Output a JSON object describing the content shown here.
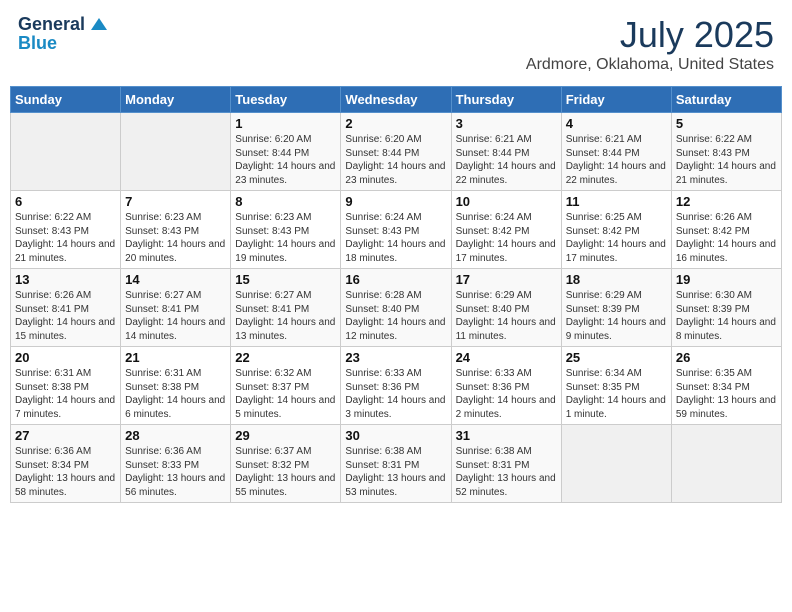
{
  "header": {
    "logo_general": "General",
    "logo_blue": "Blue",
    "month_title": "July 2025",
    "location": "Ardmore, Oklahoma, United States"
  },
  "days_of_week": [
    "Sunday",
    "Monday",
    "Tuesday",
    "Wednesday",
    "Thursday",
    "Friday",
    "Saturday"
  ],
  "weeks": [
    [
      {
        "day": "",
        "empty": true
      },
      {
        "day": "",
        "empty": true
      },
      {
        "day": "1",
        "sunrise": "6:20 AM",
        "sunset": "8:44 PM",
        "daylight": "14 hours and 23 minutes."
      },
      {
        "day": "2",
        "sunrise": "6:20 AM",
        "sunset": "8:44 PM",
        "daylight": "14 hours and 23 minutes."
      },
      {
        "day": "3",
        "sunrise": "6:21 AM",
        "sunset": "8:44 PM",
        "daylight": "14 hours and 22 minutes."
      },
      {
        "day": "4",
        "sunrise": "6:21 AM",
        "sunset": "8:44 PM",
        "daylight": "14 hours and 22 minutes."
      },
      {
        "day": "5",
        "sunrise": "6:22 AM",
        "sunset": "8:43 PM",
        "daylight": "14 hours and 21 minutes."
      }
    ],
    [
      {
        "day": "6",
        "sunrise": "6:22 AM",
        "sunset": "8:43 PM",
        "daylight": "14 hours and 21 minutes."
      },
      {
        "day": "7",
        "sunrise": "6:23 AM",
        "sunset": "8:43 PM",
        "daylight": "14 hours and 20 minutes."
      },
      {
        "day": "8",
        "sunrise": "6:23 AM",
        "sunset": "8:43 PM",
        "daylight": "14 hours and 19 minutes."
      },
      {
        "day": "9",
        "sunrise": "6:24 AM",
        "sunset": "8:43 PM",
        "daylight": "14 hours and 18 minutes."
      },
      {
        "day": "10",
        "sunrise": "6:24 AM",
        "sunset": "8:42 PM",
        "daylight": "14 hours and 17 minutes."
      },
      {
        "day": "11",
        "sunrise": "6:25 AM",
        "sunset": "8:42 PM",
        "daylight": "14 hours and 17 minutes."
      },
      {
        "day": "12",
        "sunrise": "6:26 AM",
        "sunset": "8:42 PM",
        "daylight": "14 hours and 16 minutes."
      }
    ],
    [
      {
        "day": "13",
        "sunrise": "6:26 AM",
        "sunset": "8:41 PM",
        "daylight": "14 hours and 15 minutes."
      },
      {
        "day": "14",
        "sunrise": "6:27 AM",
        "sunset": "8:41 PM",
        "daylight": "14 hours and 14 minutes."
      },
      {
        "day": "15",
        "sunrise": "6:27 AM",
        "sunset": "8:41 PM",
        "daylight": "14 hours and 13 minutes."
      },
      {
        "day": "16",
        "sunrise": "6:28 AM",
        "sunset": "8:40 PM",
        "daylight": "14 hours and 12 minutes."
      },
      {
        "day": "17",
        "sunrise": "6:29 AM",
        "sunset": "8:40 PM",
        "daylight": "14 hours and 11 minutes."
      },
      {
        "day": "18",
        "sunrise": "6:29 AM",
        "sunset": "8:39 PM",
        "daylight": "14 hours and 9 minutes."
      },
      {
        "day": "19",
        "sunrise": "6:30 AM",
        "sunset": "8:39 PM",
        "daylight": "14 hours and 8 minutes."
      }
    ],
    [
      {
        "day": "20",
        "sunrise": "6:31 AM",
        "sunset": "8:38 PM",
        "daylight": "14 hours and 7 minutes."
      },
      {
        "day": "21",
        "sunrise": "6:31 AM",
        "sunset": "8:38 PM",
        "daylight": "14 hours and 6 minutes."
      },
      {
        "day": "22",
        "sunrise": "6:32 AM",
        "sunset": "8:37 PM",
        "daylight": "14 hours and 5 minutes."
      },
      {
        "day": "23",
        "sunrise": "6:33 AM",
        "sunset": "8:36 PM",
        "daylight": "14 hours and 3 minutes."
      },
      {
        "day": "24",
        "sunrise": "6:33 AM",
        "sunset": "8:36 PM",
        "daylight": "14 hours and 2 minutes."
      },
      {
        "day": "25",
        "sunrise": "6:34 AM",
        "sunset": "8:35 PM",
        "daylight": "14 hours and 1 minute."
      },
      {
        "day": "26",
        "sunrise": "6:35 AM",
        "sunset": "8:34 PM",
        "daylight": "13 hours and 59 minutes."
      }
    ],
    [
      {
        "day": "27",
        "sunrise": "6:36 AM",
        "sunset": "8:34 PM",
        "daylight": "13 hours and 58 minutes."
      },
      {
        "day": "28",
        "sunrise": "6:36 AM",
        "sunset": "8:33 PM",
        "daylight": "13 hours and 56 minutes."
      },
      {
        "day": "29",
        "sunrise": "6:37 AM",
        "sunset": "8:32 PM",
        "daylight": "13 hours and 55 minutes."
      },
      {
        "day": "30",
        "sunrise": "6:38 AM",
        "sunset": "8:31 PM",
        "daylight": "13 hours and 53 minutes."
      },
      {
        "day": "31",
        "sunrise": "6:38 AM",
        "sunset": "8:31 PM",
        "daylight": "13 hours and 52 minutes."
      },
      {
        "day": "",
        "empty": true
      },
      {
        "day": "",
        "empty": true
      }
    ]
  ]
}
